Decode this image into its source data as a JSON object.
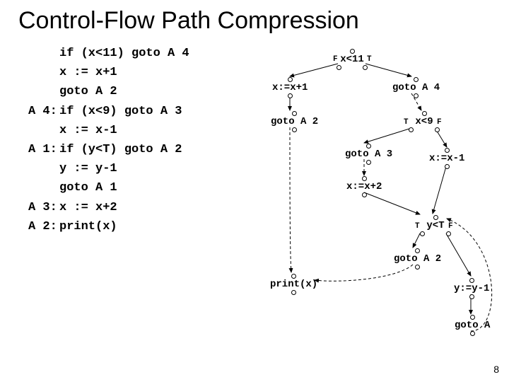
{
  "title": "Control-Flow Path Compression",
  "page_number": "8",
  "code": {
    "l1": "if (x<11) goto A 4",
    "l2": "x := x+1",
    "l3": "goto A 2",
    "g4": "A 4:",
    "l4": "if (x<9) goto A 3",
    "l5": "x := x-1",
    "g6": "A 1:",
    "l6": "if (y<T) goto A 2",
    "l7": "y := y-1",
    "l8": "goto A 1",
    "g9": "A 3:",
    "l9": "x := x+2",
    "g10": "A 2:",
    "l10": "print(x)"
  },
  "nodes": {
    "n1": "x<11",
    "n2": "x:=x+1",
    "n3": "goto A 2",
    "n4": "goto A 4",
    "n5": "x<9",
    "n6": "goto A 3",
    "n7": "x:=x+2",
    "n8": "x:=x-1",
    "n9": "y<T",
    "n10": "goto A 2",
    "n11": "print(x)",
    "n12": "y:=y-1",
    "n13": "goto A"
  },
  "labels": {
    "F": "F",
    "T": "T"
  }
}
